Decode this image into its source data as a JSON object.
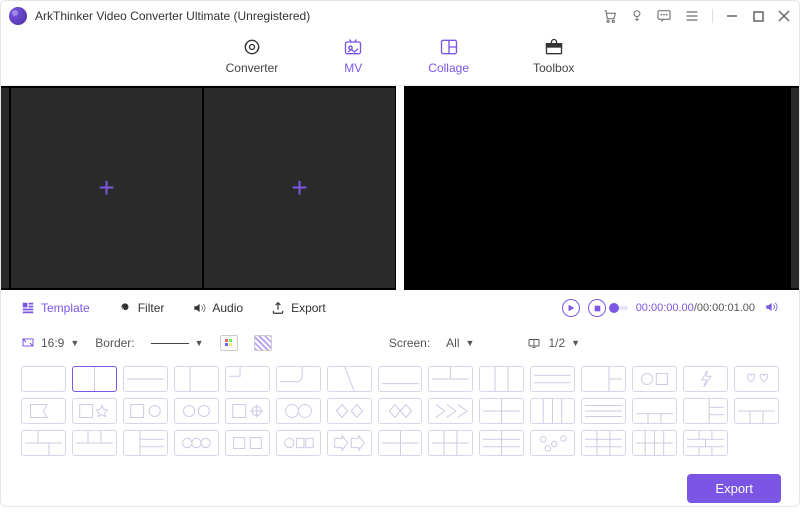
{
  "titlebar": {
    "title": "ArkThinker Video Converter Ultimate (Unregistered)"
  },
  "tabs": {
    "converter": "Converter",
    "mv": "MV",
    "collage": "Collage",
    "toolbox": "Toolbox"
  },
  "subnav": {
    "template": "Template",
    "filter": "Filter",
    "audio": "Audio",
    "export": "Export"
  },
  "playback": {
    "current": "00:00:00.00",
    "total": "00:00:01.00"
  },
  "options": {
    "ratio": "16:9",
    "border_label": "Border:",
    "screen_label": "Screen:",
    "screen_value": "All",
    "copies": "1/2"
  },
  "footer": {
    "export": "Export"
  }
}
